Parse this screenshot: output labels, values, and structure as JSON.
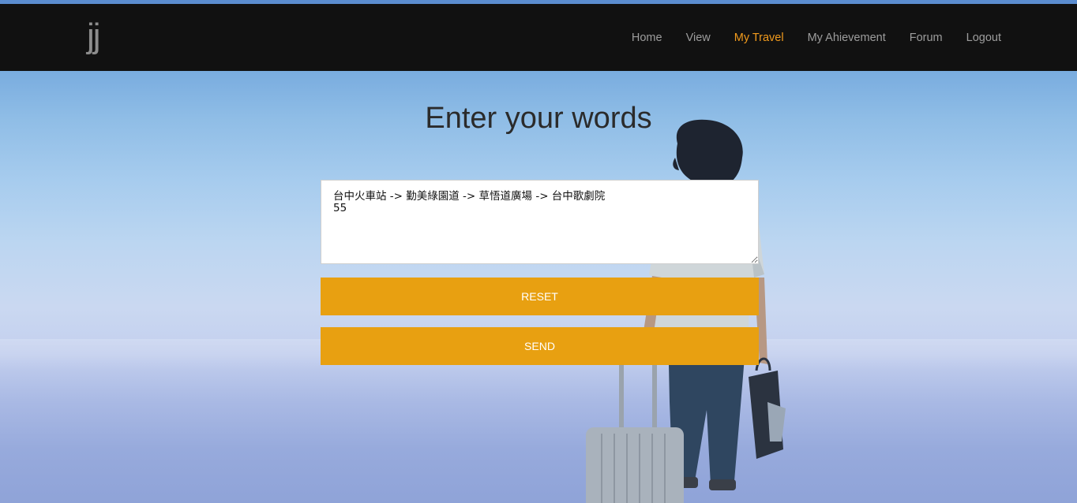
{
  "navbar": {
    "brand": "jj",
    "items": [
      {
        "label": "Home",
        "active": false
      },
      {
        "label": "View",
        "active": false
      },
      {
        "label": "My Travel",
        "active": true
      },
      {
        "label": "My Ahievement",
        "active": false
      },
      {
        "label": "Forum",
        "active": false
      },
      {
        "label": "Logout",
        "active": false
      }
    ]
  },
  "main": {
    "title": "Enter your words",
    "textarea_value": "台中火車站 -> 勤美綠園道 -> 草悟道廣場 -> 台中歌劇院\n55",
    "reset_label": "RESET",
    "send_label": "SEND"
  },
  "colors": {
    "navbar_bg": "#111111",
    "nav_text": "#9d9d9d",
    "nav_active": "#f29b1d",
    "button_bg": "#e8a011",
    "button_text": "#ffffff"
  }
}
